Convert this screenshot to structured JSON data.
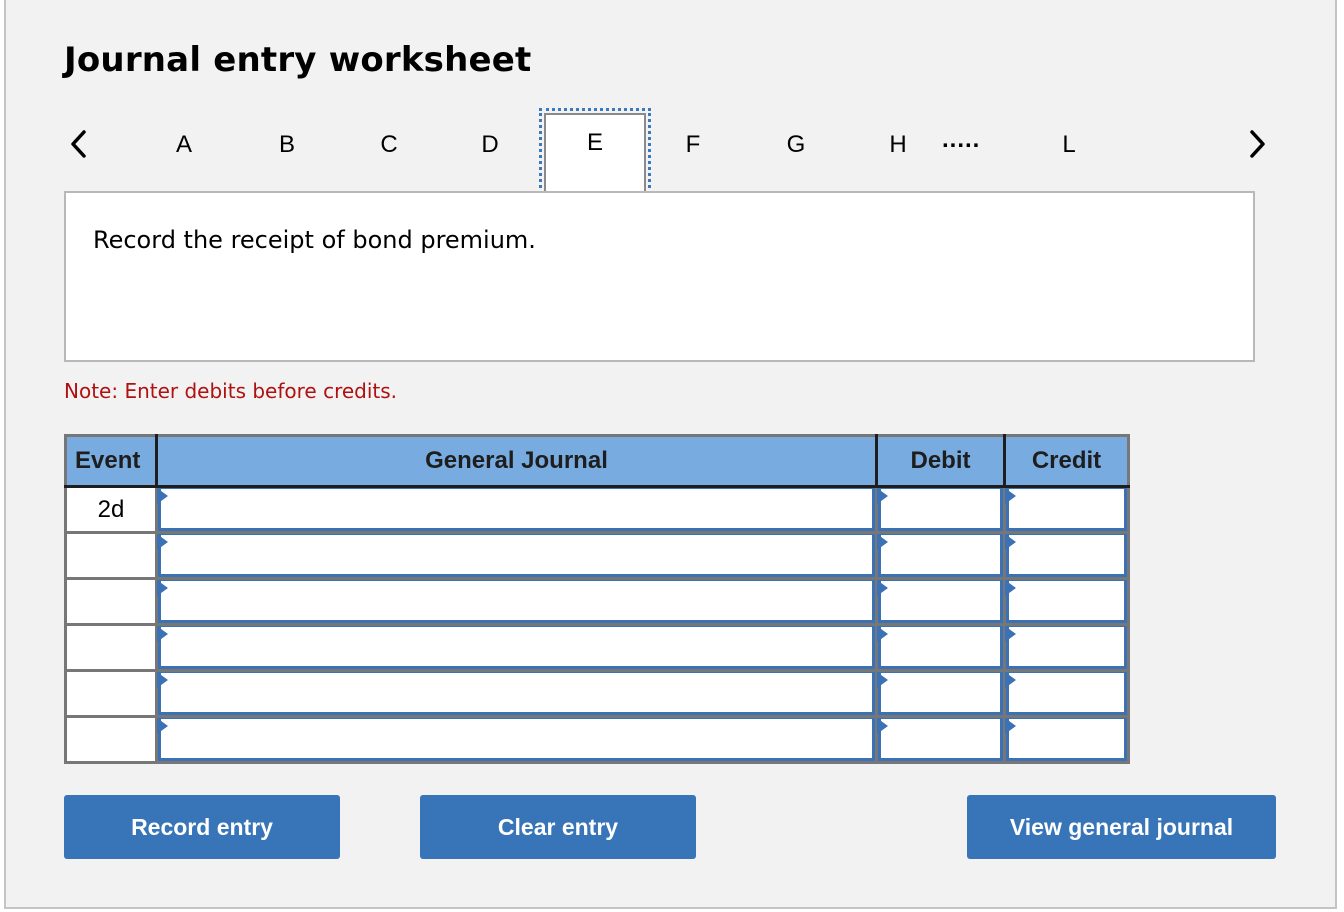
{
  "title": "Journal entry worksheet",
  "nav": {
    "prev_icon": "chevron-left-icon",
    "next_icon": "chevron-right-icon",
    "tabs": [
      "A",
      "B",
      "C",
      "D",
      "E",
      "F",
      "G",
      "H",
      "L"
    ],
    "active_tab": "E",
    "ellipsis": "....."
  },
  "description": "Record the receipt of bond premium.",
  "note": "Note: Enter debits before credits.",
  "colors": {
    "header_bg": "#78ace1",
    "button_bg": "#3875b8",
    "note_text": "#b01010",
    "active_tab_outline": "#3a78c0"
  },
  "table": {
    "headers": {
      "event": "Event",
      "general_journal": "General Journal",
      "debit": "Debit",
      "credit": "Credit"
    },
    "rows": [
      {
        "event": "2d",
        "account": "",
        "debit": "",
        "credit": ""
      },
      {
        "event": "",
        "account": "",
        "debit": "",
        "credit": ""
      },
      {
        "event": "",
        "account": "",
        "debit": "",
        "credit": ""
      },
      {
        "event": "",
        "account": "",
        "debit": "",
        "credit": ""
      },
      {
        "event": "",
        "account": "",
        "debit": "",
        "credit": ""
      },
      {
        "event": "",
        "account": "",
        "debit": "",
        "credit": ""
      }
    ]
  },
  "buttons": {
    "record": "Record entry",
    "clear": "Clear entry",
    "view": "View general journal"
  }
}
